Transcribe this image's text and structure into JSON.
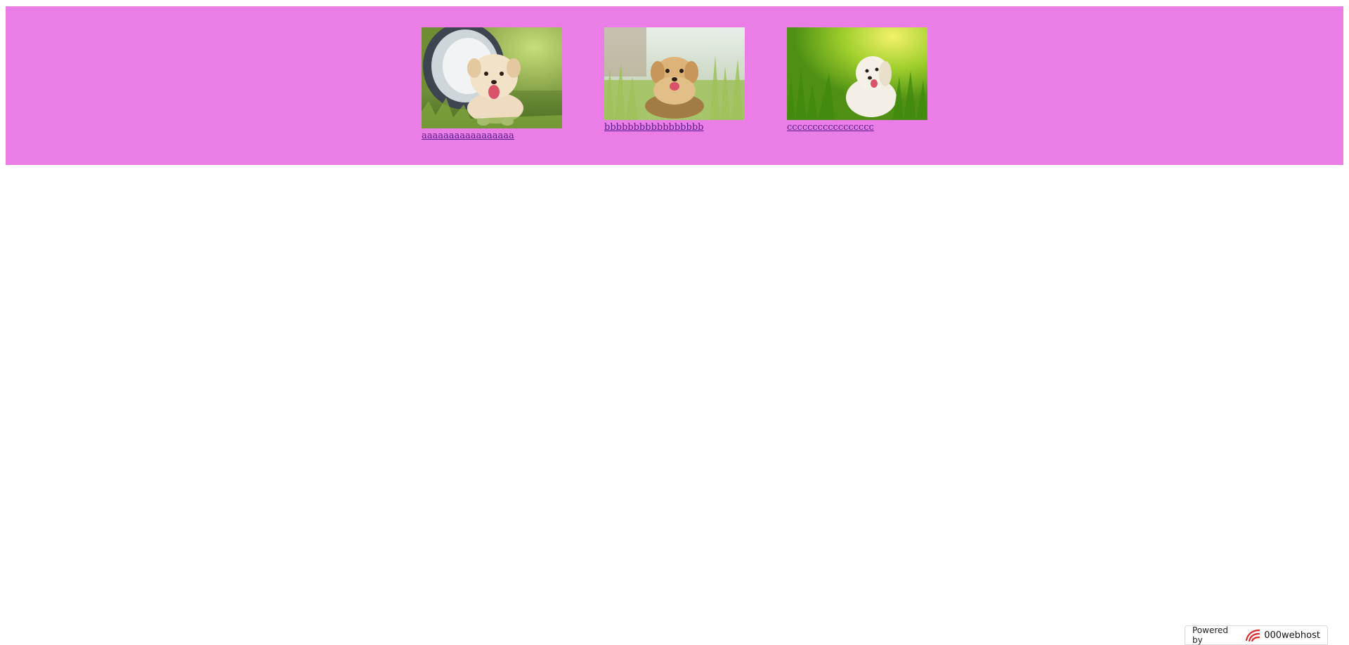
{
  "gallery": {
    "background_color": "#eb7ee6",
    "items": [
      {
        "caption": "aaaaaaaaaaaaaaaaa",
        "image": "puppy-in-bucket",
        "link_color": "#551a8b"
      },
      {
        "caption": "bbbbbbbbbbbbbbbbb",
        "image": "puppy-in-grass",
        "link_color": "#551a8b"
      },
      {
        "caption": "ccccccccccccccccc",
        "image": "puppy-in-meadow",
        "link_color": "#551a8b"
      }
    ]
  },
  "footer": {
    "powered_label": "Powered by",
    "brand": "000webhost",
    "logo_icon": "000webhost-logo-icon"
  }
}
